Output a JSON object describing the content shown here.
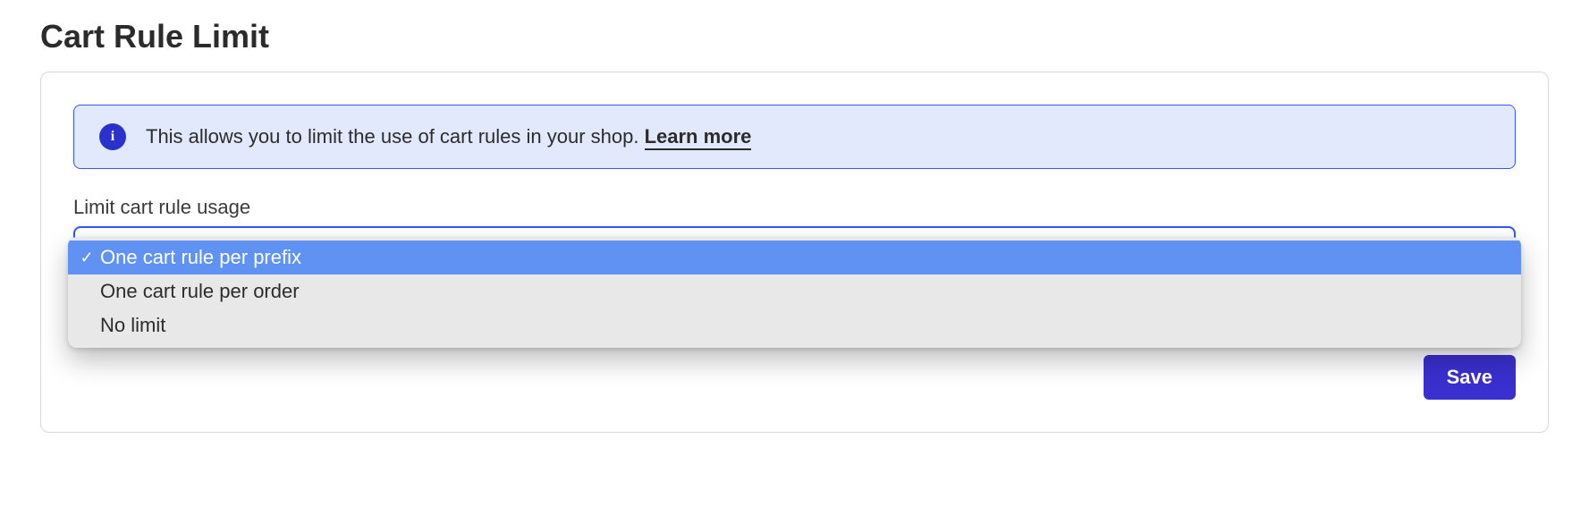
{
  "page": {
    "title": "Cart Rule Limit"
  },
  "info": {
    "text": "This allows you to limit the use of cart rules in your shop. ",
    "learn_more": "Learn more",
    "icon_glyph": "i"
  },
  "field": {
    "label": "Limit cart rule usage"
  },
  "dropdown": {
    "options": [
      {
        "label": "One cart rule per prefix",
        "selected": true
      },
      {
        "label": "One cart rule per order",
        "selected": false
      },
      {
        "label": "No limit",
        "selected": false
      }
    ],
    "check_glyph": "✓"
  },
  "actions": {
    "save": "Save"
  }
}
